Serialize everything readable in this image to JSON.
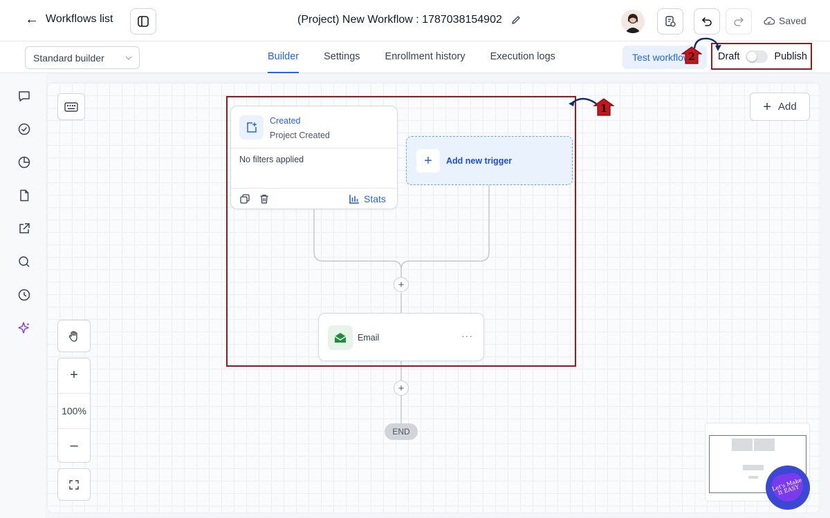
{
  "header": {
    "back_label": "Workflows list",
    "workflow_title": "(Project) New Workflow : 1787038154902",
    "saved_label": "Saved"
  },
  "subheader": {
    "builder_select": "Standard builder",
    "tabs": [
      {
        "label": "Builder",
        "active": true
      },
      {
        "label": "Settings",
        "active": false
      },
      {
        "label": "Enrollment history",
        "active": false
      },
      {
        "label": "Execution logs",
        "active": false
      }
    ],
    "test_button": "Test workflow",
    "draft_label": "Draft",
    "publish_label": "Publish",
    "publish_enabled": false
  },
  "canvas": {
    "add_button": "Add",
    "zoom_level": "100%",
    "trigger_card": {
      "title": "Created",
      "subtitle": "Project Created",
      "filters_text": "No filters applied",
      "stats_label": "Stats"
    },
    "new_trigger_label": "Add new trigger",
    "action_node": {
      "label": "Email",
      "more": "···"
    },
    "end_label": "END"
  },
  "annotations": {
    "marker_1": "1",
    "marker_2": "2"
  },
  "watermark": {
    "text": "Let's Make It EASY"
  },
  "colors": {
    "accent": "#2563eb",
    "highlight_border": "#a31515",
    "email_icon": "#1e8e3e",
    "ai_icon": "#7c3aed"
  },
  "icons": {
    "rail": [
      "chat-icon",
      "check-circle-icon",
      "pie-chart-icon",
      "file-icon",
      "external-link-icon",
      "search-icon",
      "history-icon",
      "sparkle-icon"
    ]
  }
}
